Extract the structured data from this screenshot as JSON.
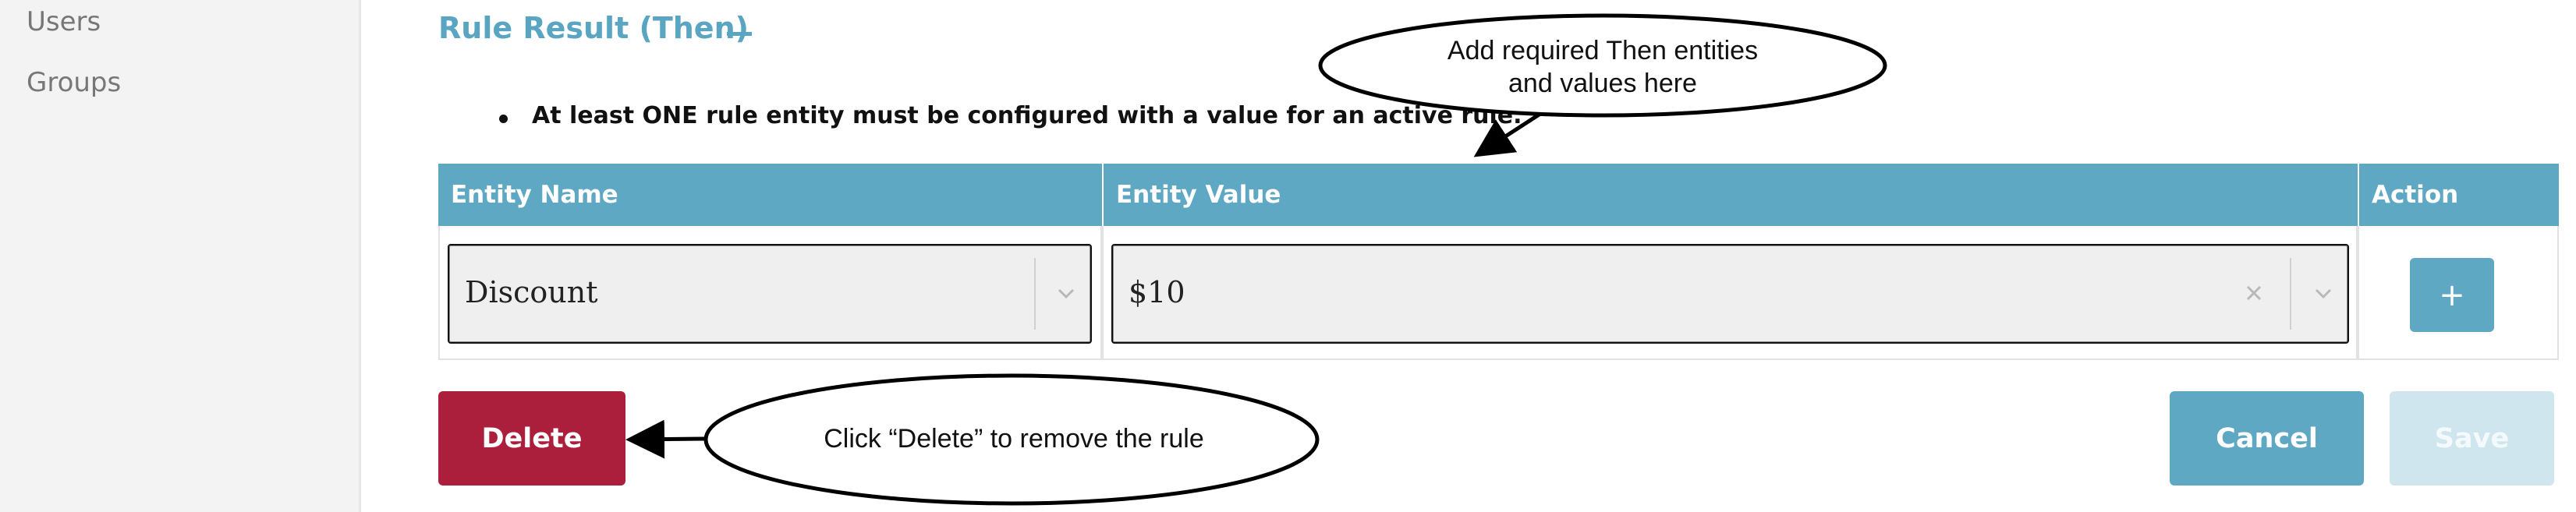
{
  "sidebar": {
    "items": [
      {
        "label": "Users"
      },
      {
        "label": "Groups"
      }
    ]
  },
  "section": {
    "title": "Rule Result (Then)",
    "collapse_icon": "minus-icon",
    "bullet": "At least ONE rule entity must be configured with a value for an active rule."
  },
  "table": {
    "headers": {
      "name": "Entity Name",
      "value": "Entity Value",
      "action": "Action"
    },
    "rows": [
      {
        "entity_name": "Discount",
        "entity_value": "$10",
        "action_label": "+"
      }
    ]
  },
  "buttons": {
    "delete": "Delete",
    "cancel": "Cancel",
    "save": "Save"
  },
  "annotations": {
    "top_line1": "Add required Then entities",
    "top_line2": "and values here",
    "bottom": "Click “Delete” to remove the rule"
  },
  "colors": {
    "accent": "#5ea8c3",
    "delete": "#ab1f3d",
    "save_disabled": "#cfe6ee"
  }
}
